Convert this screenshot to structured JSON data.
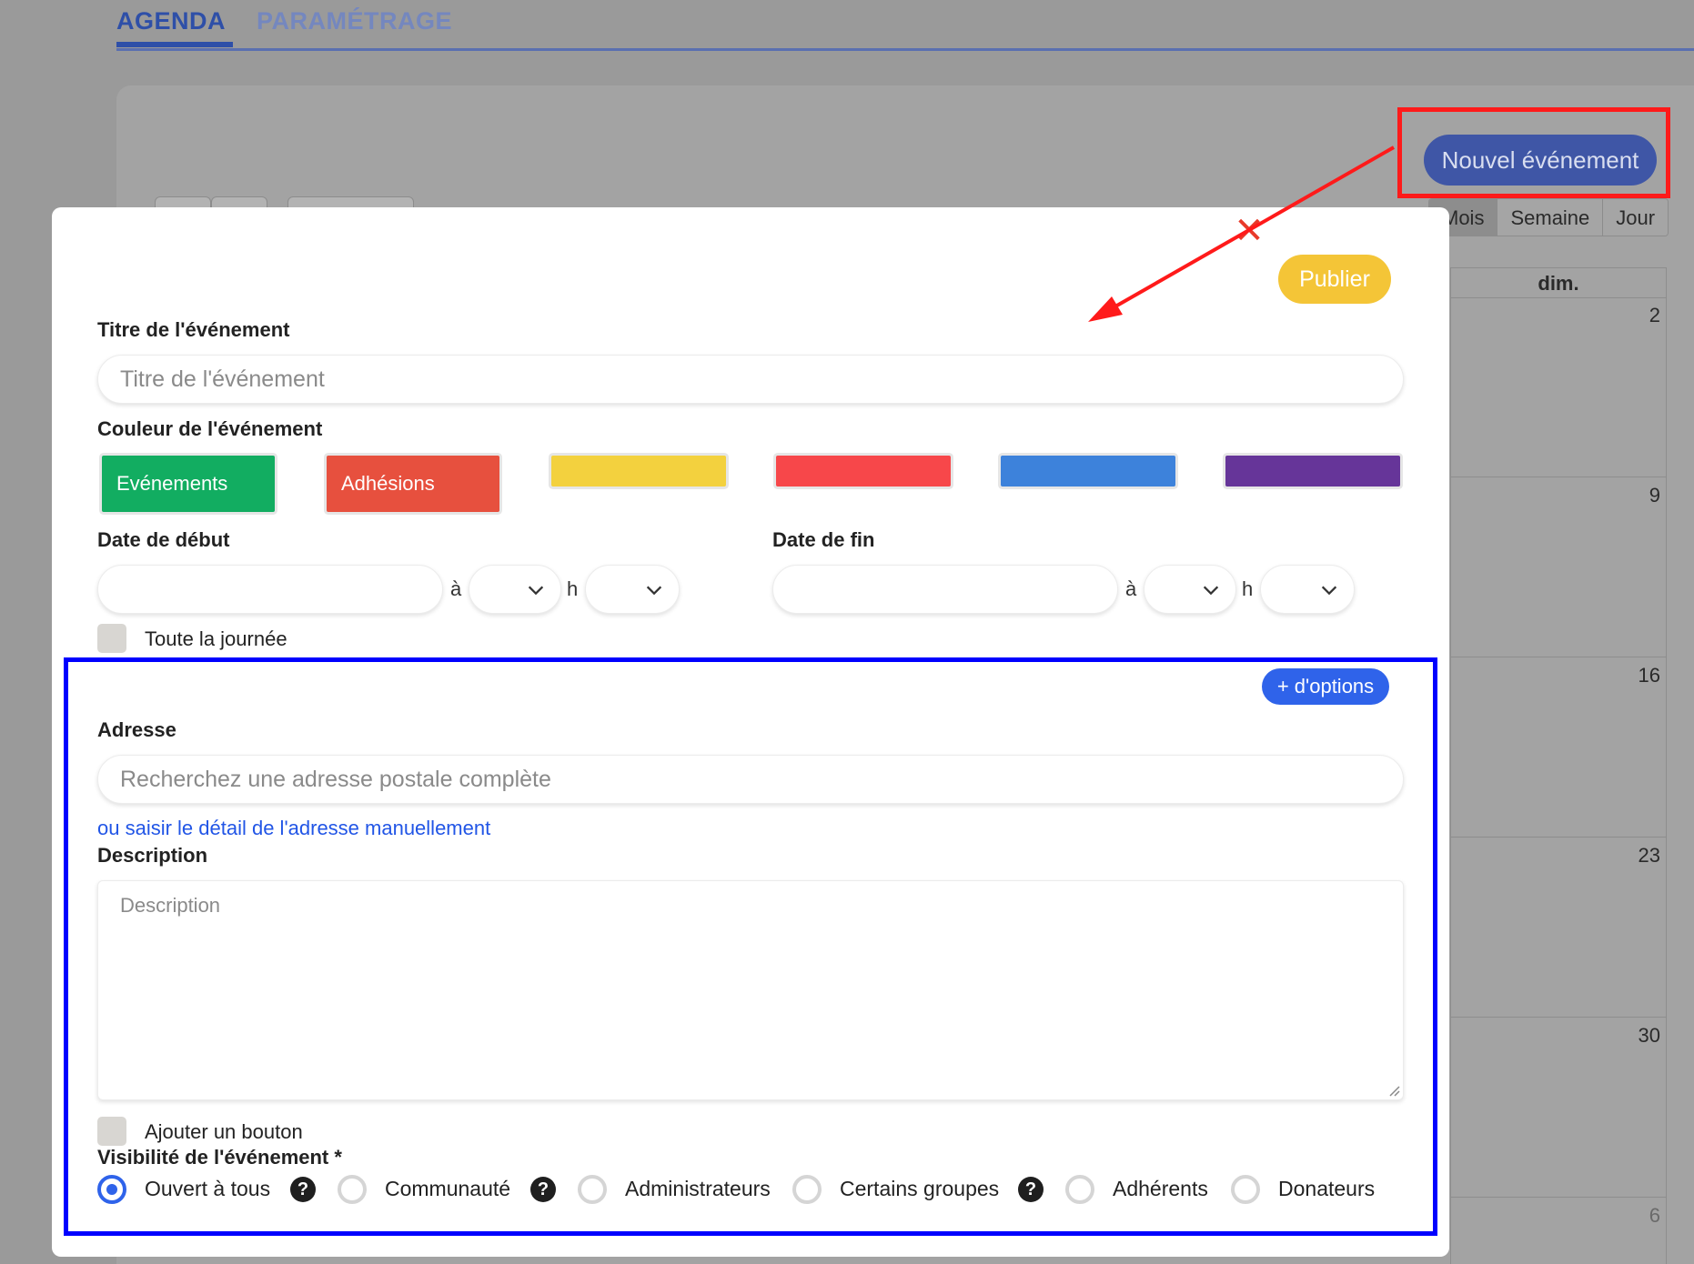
{
  "tabs": {
    "agenda": "AGENDA",
    "parametrage": "PARAMÉTRAGE"
  },
  "toolbar": {
    "new_event_label": "Nouvel événement"
  },
  "calendar": {
    "views": [
      "Mois",
      "Semaine",
      "Jour"
    ],
    "active_view": "Mois",
    "day_header": "dim.",
    "day_numbers": [
      "2",
      "9",
      "16",
      "23",
      "30",
      "6"
    ]
  },
  "modal": {
    "close_icon": "close-icon",
    "publish_label": "Publier",
    "title_label": "Titre de l'événement",
    "title_placeholder": "Titre de l'événement",
    "color_label": "Couleur de l'événement",
    "colors": [
      {
        "label": "Evénements",
        "hex": "#12ad61"
      },
      {
        "label": "Adhésions",
        "hex": "#e7503e"
      },
      {
        "label": "",
        "hex": "#f3d13e"
      },
      {
        "label": "",
        "hex": "#f7474a"
      },
      {
        "label": "",
        "hex": "#3d82db"
      },
      {
        "label": "",
        "hex": "#663599"
      }
    ],
    "start_date_label": "Date de début",
    "end_date_label": "Date de fin",
    "at_sep": "à",
    "hour_sep": "h",
    "all_day_label": "Toute la journée",
    "more_options_label": "+ d'options",
    "address_label": "Adresse",
    "address_placeholder": "Recherchez une adresse postale complète",
    "manual_address_link": "ou saisir le détail de l'adresse manuellement",
    "description_label": "Description",
    "description_placeholder": "Description",
    "add_button_label": "Ajouter un bouton",
    "visibility_label": "Visibilité de l'événement *",
    "visibility_options": [
      {
        "label": "Ouvert à tous",
        "selected": true,
        "help": true
      },
      {
        "label": "Communauté",
        "selected": false,
        "help": true
      },
      {
        "label": "Administrateurs",
        "selected": false,
        "help": false
      },
      {
        "label": "Certains groupes",
        "selected": false,
        "help": true
      },
      {
        "label": "Adhérents",
        "selected": false,
        "help": false
      },
      {
        "label": "Donateurs",
        "selected": false,
        "help": false
      }
    ],
    "help_glyph": "?"
  },
  "annotations": {
    "highlight_new_color": "#ff1a1a",
    "highlight_options_color": "#0000ff"
  },
  "colors": {
    "primary": "#2f63ea",
    "publish": "#f4c537"
  }
}
